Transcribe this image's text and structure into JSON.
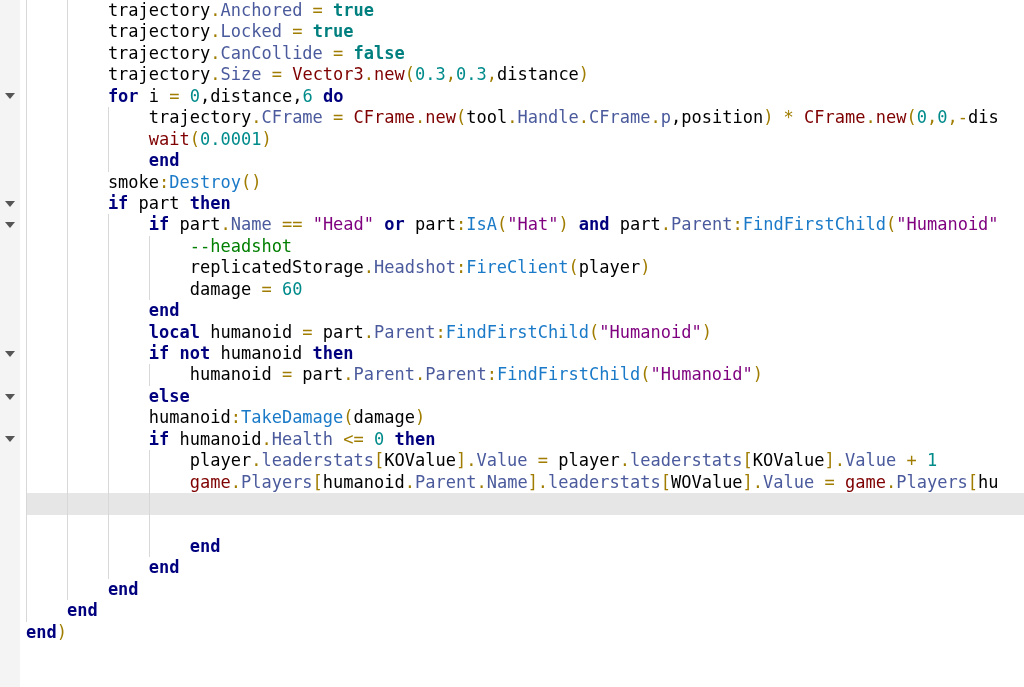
{
  "lines": [
    {
      "children": [
        {
          "children": [
            {
              "foldable": false,
              "current": false,
              "segments": [
                {
                  "kind": "plain",
                  "text": "trajectory"
                },
                {
                  "kind": "op",
                  "text": "."
                },
                {
                  "kind": "prop",
                  "text": "Anchored"
                },
                {
                  "kind": "op",
                  "text": " = "
                },
                {
                  "kind": "bool",
                  "text": "true"
                }
              ]
            },
            {
              "foldable": false,
              "current": false,
              "segments": [
                {
                  "kind": "plain",
                  "text": "trajectory"
                },
                {
                  "kind": "op",
                  "text": "."
                },
                {
                  "kind": "prop",
                  "text": "Locked"
                },
                {
                  "kind": "op",
                  "text": " = "
                },
                {
                  "kind": "bool",
                  "text": "true"
                }
              ]
            },
            {
              "foldable": false,
              "current": false,
              "segments": [
                {
                  "kind": "plain",
                  "text": "trajectory"
                },
                {
                  "kind": "op",
                  "text": "."
                },
                {
                  "kind": "prop",
                  "text": "CanCollide"
                },
                {
                  "kind": "op",
                  "text": " = "
                },
                {
                  "kind": "bool",
                  "text": "false"
                }
              ]
            },
            {
              "foldable": false,
              "current": false,
              "segments": [
                {
                  "kind": "plain",
                  "text": "trajectory"
                },
                {
                  "kind": "op",
                  "text": "."
                },
                {
                  "kind": "prop",
                  "text": "Size"
                },
                {
                  "kind": "op",
                  "text": " = "
                },
                {
                  "kind": "builtin",
                  "text": "Vector3"
                },
                {
                  "kind": "op",
                  "text": "."
                },
                {
                  "kind": "builtin",
                  "text": "new"
                },
                {
                  "kind": "op",
                  "text": "("
                },
                {
                  "kind": "num",
                  "text": "0.3"
                },
                {
                  "kind": "op",
                  "text": ","
                },
                {
                  "kind": "num",
                  "text": "0.3"
                },
                {
                  "kind": "op",
                  "text": ","
                },
                {
                  "kind": "plain",
                  "text": "distance"
                },
                {
                  "kind": "op",
                  "text": ")"
                }
              ]
            },
            {
              "foldable": true,
              "current": false,
              "segments": [
                {
                  "kind": "kw",
                  "text": "for"
                },
                {
                  "kind": "plain",
                  "text": " i "
                },
                {
                  "kind": "op",
                  "text": "= "
                },
                {
                  "kind": "num",
                  "text": "0"
                },
                {
                  "kind": "plain",
                  "text": ",distance,"
                },
                {
                  "kind": "num",
                  "text": "6"
                },
                {
                  "kind": "kw",
                  "text": " do"
                }
              ]
            },
            {
              "children": [
                {
                  "foldable": false,
                  "current": false,
                  "segments": [
                    {
                      "kind": "plain",
                      "text": "trajectory"
                    },
                    {
                      "kind": "op",
                      "text": "."
                    },
                    {
                      "kind": "prop",
                      "text": "CFrame"
                    },
                    {
                      "kind": "op",
                      "text": " = "
                    },
                    {
                      "kind": "builtin",
                      "text": "CFrame"
                    },
                    {
                      "kind": "op",
                      "text": "."
                    },
                    {
                      "kind": "builtin",
                      "text": "new"
                    },
                    {
                      "kind": "op",
                      "text": "("
                    },
                    {
                      "kind": "plain",
                      "text": "tool"
                    },
                    {
                      "kind": "op",
                      "text": "."
                    },
                    {
                      "kind": "prop",
                      "text": "Handle"
                    },
                    {
                      "kind": "op",
                      "text": "."
                    },
                    {
                      "kind": "prop",
                      "text": "CFrame"
                    },
                    {
                      "kind": "op",
                      "text": "."
                    },
                    {
                      "kind": "prop",
                      "text": "p"
                    },
                    {
                      "kind": "plain",
                      "text": ",position"
                    },
                    {
                      "kind": "op",
                      "text": ") * "
                    },
                    {
                      "kind": "builtin",
                      "text": "CFrame"
                    },
                    {
                      "kind": "op",
                      "text": "."
                    },
                    {
                      "kind": "builtin",
                      "text": "new"
                    },
                    {
                      "kind": "op",
                      "text": "("
                    },
                    {
                      "kind": "num",
                      "text": "0"
                    },
                    {
                      "kind": "op",
                      "text": ","
                    },
                    {
                      "kind": "num",
                      "text": "0"
                    },
                    {
                      "kind": "op",
                      "text": ",-"
                    },
                    {
                      "kind": "plain",
                      "text": "dis"
                    }
                  ]
                },
                {
                  "foldable": false,
                  "current": false,
                  "segments": [
                    {
                      "kind": "builtin",
                      "text": "wait"
                    },
                    {
                      "kind": "op",
                      "text": "("
                    },
                    {
                      "kind": "num",
                      "text": "0.0001"
                    },
                    {
                      "kind": "op",
                      "text": ")"
                    }
                  ]
                },
                {
                  "foldable": false,
                  "current": false,
                  "segments": [
                    {
                      "kind": "kw",
                      "text": "end"
                    }
                  ]
                }
              ]
            },
            {
              "foldable": false,
              "current": false,
              "segments": [
                {
                  "kind": "plain",
                  "text": "smoke"
                },
                {
                  "kind": "op",
                  "text": ":"
                },
                {
                  "kind": "method",
                  "text": "Destroy"
                },
                {
                  "kind": "op",
                  "text": "()"
                }
              ]
            },
            {
              "foldable": true,
              "current": false,
              "segments": [
                {
                  "kind": "kw",
                  "text": "if"
                },
                {
                  "kind": "plain",
                  "text": " part "
                },
                {
                  "kind": "kw",
                  "text": "then"
                }
              ]
            },
            {
              "children": [
                {
                  "foldable": true,
                  "current": false,
                  "segments": [
                    {
                      "kind": "kw",
                      "text": "if"
                    },
                    {
                      "kind": "plain",
                      "text": " part"
                    },
                    {
                      "kind": "op",
                      "text": "."
                    },
                    {
                      "kind": "prop",
                      "text": "Name"
                    },
                    {
                      "kind": "op",
                      "text": " == "
                    },
                    {
                      "kind": "str",
                      "text": "\"Head\""
                    },
                    {
                      "kind": "kw",
                      "text": " or"
                    },
                    {
                      "kind": "plain",
                      "text": " part"
                    },
                    {
                      "kind": "op",
                      "text": ":"
                    },
                    {
                      "kind": "method",
                      "text": "IsA"
                    },
                    {
                      "kind": "op",
                      "text": "("
                    },
                    {
                      "kind": "str",
                      "text": "\"Hat\""
                    },
                    {
                      "kind": "op",
                      "text": ") "
                    },
                    {
                      "kind": "kw",
                      "text": "and"
                    },
                    {
                      "kind": "plain",
                      "text": " part"
                    },
                    {
                      "kind": "op",
                      "text": "."
                    },
                    {
                      "kind": "prop",
                      "text": "Parent"
                    },
                    {
                      "kind": "op",
                      "text": ":"
                    },
                    {
                      "kind": "method",
                      "text": "FindFirstChild"
                    },
                    {
                      "kind": "op",
                      "text": "("
                    },
                    {
                      "kind": "str",
                      "text": "\"Humanoid\""
                    }
                  ]
                },
                {
                  "children": [
                    {
                      "foldable": false,
                      "current": false,
                      "segments": [
                        {
                          "kind": "comment",
                          "text": "--headshot"
                        }
                      ]
                    },
                    {
                      "foldable": false,
                      "current": false,
                      "segments": [
                        {
                          "kind": "plain",
                          "text": "replicatedStorage"
                        },
                        {
                          "kind": "op",
                          "text": "."
                        },
                        {
                          "kind": "prop",
                          "text": "Headshot"
                        },
                        {
                          "kind": "op",
                          "text": ":"
                        },
                        {
                          "kind": "method",
                          "text": "FireClient"
                        },
                        {
                          "kind": "op",
                          "text": "("
                        },
                        {
                          "kind": "plain",
                          "text": "player"
                        },
                        {
                          "kind": "op",
                          "text": ")"
                        }
                      ]
                    },
                    {
                      "foldable": false,
                      "current": false,
                      "segments": [
                        {
                          "kind": "plain",
                          "text": "damage "
                        },
                        {
                          "kind": "op",
                          "text": "= "
                        },
                        {
                          "kind": "num",
                          "text": "60"
                        }
                      ]
                    }
                  ]
                },
                {
                  "foldable": false,
                  "current": false,
                  "segments": [
                    {
                      "kind": "kw",
                      "text": "end"
                    }
                  ]
                },
                {
                  "foldable": false,
                  "current": false,
                  "segments": [
                    {
                      "kind": "kw",
                      "text": "local"
                    },
                    {
                      "kind": "plain",
                      "text": " humanoid "
                    },
                    {
                      "kind": "op",
                      "text": "= "
                    },
                    {
                      "kind": "plain",
                      "text": "part"
                    },
                    {
                      "kind": "op",
                      "text": "."
                    },
                    {
                      "kind": "prop",
                      "text": "Parent"
                    },
                    {
                      "kind": "op",
                      "text": ":"
                    },
                    {
                      "kind": "method",
                      "text": "FindFirstChild"
                    },
                    {
                      "kind": "op",
                      "text": "("
                    },
                    {
                      "kind": "str",
                      "text": "\"Humanoid\""
                    },
                    {
                      "kind": "op",
                      "text": ")"
                    }
                  ]
                },
                {
                  "foldable": true,
                  "current": false,
                  "segments": [
                    {
                      "kind": "kw",
                      "text": "if not"
                    },
                    {
                      "kind": "plain",
                      "text": " humanoid "
                    },
                    {
                      "kind": "kw",
                      "text": "then"
                    }
                  ]
                },
                {
                  "children": [
                    {
                      "foldable": false,
                      "current": false,
                      "segments": [
                        {
                          "kind": "plain",
                          "text": "humanoid "
                        },
                        {
                          "kind": "op",
                          "text": "= "
                        },
                        {
                          "kind": "plain",
                          "text": "part"
                        },
                        {
                          "kind": "op",
                          "text": "."
                        },
                        {
                          "kind": "prop",
                          "text": "Parent"
                        },
                        {
                          "kind": "op",
                          "text": "."
                        },
                        {
                          "kind": "prop",
                          "text": "Parent"
                        },
                        {
                          "kind": "op",
                          "text": ":"
                        },
                        {
                          "kind": "method",
                          "text": "FindFirstChild"
                        },
                        {
                          "kind": "op",
                          "text": "("
                        },
                        {
                          "kind": "str",
                          "text": "\"Humanoid\""
                        },
                        {
                          "kind": "op",
                          "text": ")"
                        }
                      ]
                    }
                  ]
                },
                {
                  "foldable": true,
                  "current": false,
                  "segments": [
                    {
                      "kind": "kw",
                      "text": "else"
                    }
                  ]
                },
                {
                  "foldable": false,
                  "current": false,
                  "segments": [
                    {
                      "kind": "plain",
                      "text": "humanoid"
                    },
                    {
                      "kind": "op",
                      "text": ":"
                    },
                    {
                      "kind": "method",
                      "text": "TakeDamage"
                    },
                    {
                      "kind": "op",
                      "text": "("
                    },
                    {
                      "kind": "plain",
                      "text": "damage"
                    },
                    {
                      "kind": "op",
                      "text": ")"
                    }
                  ]
                },
                {
                  "foldable": true,
                  "current": false,
                  "segments": [
                    {
                      "kind": "kw",
                      "text": "if"
                    },
                    {
                      "kind": "plain",
                      "text": " humanoid"
                    },
                    {
                      "kind": "op",
                      "text": "."
                    },
                    {
                      "kind": "prop",
                      "text": "Health"
                    },
                    {
                      "kind": "op",
                      "text": " <= "
                    },
                    {
                      "kind": "num",
                      "text": "0"
                    },
                    {
                      "kind": "kw",
                      "text": " then"
                    }
                  ]
                },
                {
                  "children": [
                    {
                      "foldable": false,
                      "current": false,
                      "segments": [
                        {
                          "kind": "plain",
                          "text": "player"
                        },
                        {
                          "kind": "op",
                          "text": "."
                        },
                        {
                          "kind": "prop",
                          "text": "leaderstats"
                        },
                        {
                          "kind": "op",
                          "text": "["
                        },
                        {
                          "kind": "plain",
                          "text": "KOValue"
                        },
                        {
                          "kind": "op",
                          "text": "]."
                        },
                        {
                          "kind": "prop",
                          "text": "Value"
                        },
                        {
                          "kind": "op",
                          "text": " = "
                        },
                        {
                          "kind": "plain",
                          "text": "player"
                        },
                        {
                          "kind": "op",
                          "text": "."
                        },
                        {
                          "kind": "prop",
                          "text": "leaderstats"
                        },
                        {
                          "kind": "op",
                          "text": "["
                        },
                        {
                          "kind": "plain",
                          "text": "KOValue"
                        },
                        {
                          "kind": "op",
                          "text": "]."
                        },
                        {
                          "kind": "prop",
                          "text": "Value"
                        },
                        {
                          "kind": "op",
                          "text": " + "
                        },
                        {
                          "kind": "num",
                          "text": "1"
                        }
                      ]
                    },
                    {
                      "foldable": false,
                      "current": false,
                      "segments": [
                        {
                          "kind": "builtin",
                          "text": "game"
                        },
                        {
                          "kind": "op",
                          "text": "."
                        },
                        {
                          "kind": "prop",
                          "text": "Players"
                        },
                        {
                          "kind": "op",
                          "text": "["
                        },
                        {
                          "kind": "plain",
                          "text": "humanoid"
                        },
                        {
                          "kind": "op",
                          "text": "."
                        },
                        {
                          "kind": "prop",
                          "text": "Parent"
                        },
                        {
                          "kind": "op",
                          "text": "."
                        },
                        {
                          "kind": "prop",
                          "text": "Name"
                        },
                        {
                          "kind": "op",
                          "text": "]."
                        },
                        {
                          "kind": "prop",
                          "text": "leaderstats"
                        },
                        {
                          "kind": "op",
                          "text": "["
                        },
                        {
                          "kind": "plain",
                          "text": "WOValue"
                        },
                        {
                          "kind": "op",
                          "text": "]."
                        },
                        {
                          "kind": "prop",
                          "text": "Value"
                        },
                        {
                          "kind": "op",
                          "text": " = "
                        },
                        {
                          "kind": "builtin",
                          "text": "game"
                        },
                        {
                          "kind": "op",
                          "text": "."
                        },
                        {
                          "kind": "prop",
                          "text": "Players"
                        },
                        {
                          "kind": "op",
                          "text": "["
                        },
                        {
                          "kind": "plain",
                          "text": "hu"
                        }
                      ]
                    },
                    {
                      "foldable": false,
                      "current": true
                    },
                    {
                      "foldable": false,
                      "current": false
                    },
                    {
                      "foldable": false,
                      "current": false,
                      "segments": [
                        {
                          "kind": "kw",
                          "text": "end"
                        }
                      ]
                    }
                  ]
                },
                {
                  "foldable": false,
                  "current": false,
                  "segments": [
                    {
                      "kind": "kw",
                      "text": "end"
                    }
                  ]
                }
              ]
            },
            {
              "foldable": false,
              "current": false,
              "segments": [
                {
                  "kind": "kw",
                  "text": "end"
                }
              ]
            }
          ]
        },
        {
          "foldable": false,
          "current": false,
          "segments": [
            {
              "kind": "kw",
              "text": "end"
            }
          ]
        }
      ]
    },
    {
      "foldable": false,
      "current": false,
      "segments": [
        {
          "kind": "kw",
          "text": "end"
        },
        {
          "kind": "op",
          "text": ")"
        }
      ]
    }
  ]
}
